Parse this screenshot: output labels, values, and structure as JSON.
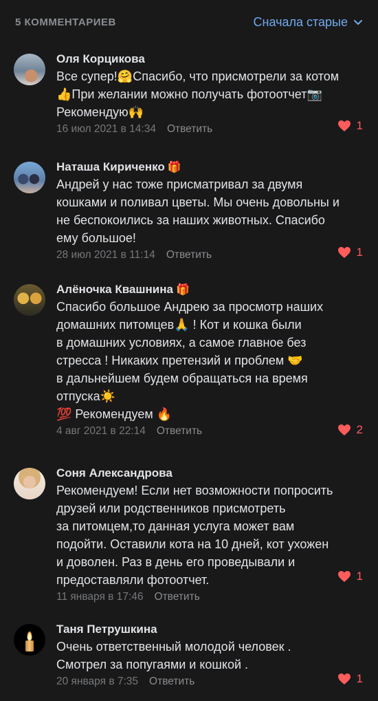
{
  "header": {
    "count": "5 КОММЕНТАРИЕВ",
    "sort_label": "Сначала старые",
    "accent": "#71aaeb"
  },
  "like_color": "#ff5c5c",
  "reply_label": "Ответить",
  "comments": [
    {
      "name": "Оля Корцикова",
      "lines": [
        "Все супер!🤗Спасибо, что присмотрели за котом",
        "👍При желании можно получать фотоотчет📷",
        "Рекомендую🙌"
      ],
      "date": "16 июл 2021 в 14:34",
      "likes": "1"
    },
    {
      "name": "Наташа Кириченко",
      "badge": "🎁",
      "lines": [
        "Андрей у нас тоже присматривал за двумя",
        "кошками и поливал цветы. Мы очень довольны и",
        "не беспокоились за наших животных. Спасибо",
        "ему большое!"
      ],
      "date": "28 июл 2021 в 11:14",
      "likes": "1"
    },
    {
      "name": "Алёночка Квашнина",
      "badge": "🎁",
      "lines": [
        "Спасибо большое Андрею за просмотр наших",
        "домашних питомцев🙏 ! Кот и кошка были",
        "в домашних условиях, а самое  главное без",
        "стресса ! Никаких претензий и проблем 🤝",
        "в дальнейшем будем обращаться на время",
        "отпуска☀️",
        "💯 Рекомендуем 🔥"
      ],
      "date": "4 авг 2021 в 22:14",
      "likes": "2"
    },
    {
      "name": "Соня Александрова",
      "lines": [
        "Рекомендуем! Если нет возможности попросить",
        "друзей или родственников присмотреть",
        "за питомцем,то данная услуга может вам",
        "подойти. Оставили кота на 10 дней, кот ухожен",
        "и доволен. Раз в день его проведывали и",
        "предоставляли фотоотчет."
      ],
      "date": "11 января в 17:46",
      "likes": "1"
    },
    {
      "name": "Таня Петрушкина",
      "lines": [
        "Очень ответственный молодой человек .",
        "Смотрел за попугаями и кошкой ."
      ],
      "date": "20 января в 7:35",
      "likes": "1"
    }
  ]
}
